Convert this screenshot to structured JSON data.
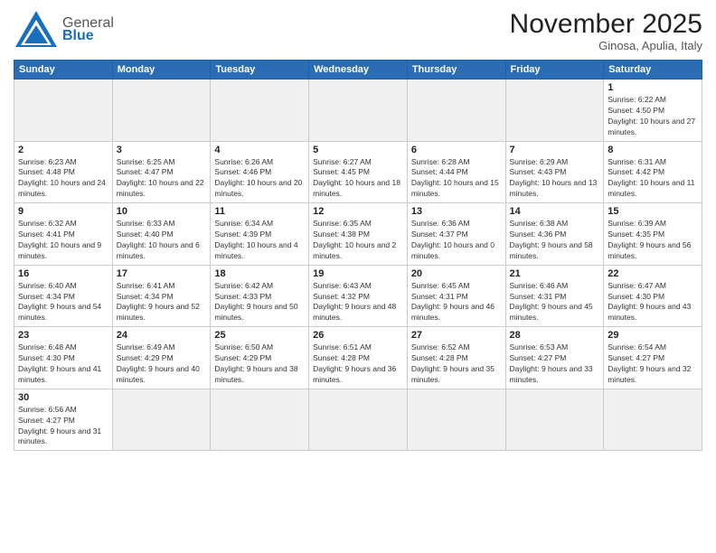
{
  "header": {
    "logo_general": "General",
    "logo_blue": "Blue",
    "month_title": "November 2025",
    "subtitle": "Ginosa, Apulia, Italy"
  },
  "weekdays": [
    "Sunday",
    "Monday",
    "Tuesday",
    "Wednesday",
    "Thursday",
    "Friday",
    "Saturday"
  ],
  "weeks": [
    [
      {
        "day": "",
        "empty": true
      },
      {
        "day": "",
        "empty": true
      },
      {
        "day": "",
        "empty": true
      },
      {
        "day": "",
        "empty": true
      },
      {
        "day": "",
        "empty": true
      },
      {
        "day": "",
        "empty": true
      },
      {
        "day": "1",
        "sunrise": "6:22 AM",
        "sunset": "4:50 PM",
        "daylight": "10 hours and 27 minutes."
      }
    ],
    [
      {
        "day": "2",
        "sunrise": "6:23 AM",
        "sunset": "4:48 PM",
        "daylight": "10 hours and 24 minutes."
      },
      {
        "day": "3",
        "sunrise": "6:25 AM",
        "sunset": "4:47 PM",
        "daylight": "10 hours and 22 minutes."
      },
      {
        "day": "4",
        "sunrise": "6:26 AM",
        "sunset": "4:46 PM",
        "daylight": "10 hours and 20 minutes."
      },
      {
        "day": "5",
        "sunrise": "6:27 AM",
        "sunset": "4:45 PM",
        "daylight": "10 hours and 18 minutes."
      },
      {
        "day": "6",
        "sunrise": "6:28 AM",
        "sunset": "4:44 PM",
        "daylight": "10 hours and 15 minutes."
      },
      {
        "day": "7",
        "sunrise": "6:29 AM",
        "sunset": "4:43 PM",
        "daylight": "10 hours and 13 minutes."
      },
      {
        "day": "8",
        "sunrise": "6:31 AM",
        "sunset": "4:42 PM",
        "daylight": "10 hours and 11 minutes."
      }
    ],
    [
      {
        "day": "9",
        "sunrise": "6:32 AM",
        "sunset": "4:41 PM",
        "daylight": "10 hours and 9 minutes."
      },
      {
        "day": "10",
        "sunrise": "6:33 AM",
        "sunset": "4:40 PM",
        "daylight": "10 hours and 6 minutes."
      },
      {
        "day": "11",
        "sunrise": "6:34 AM",
        "sunset": "4:39 PM",
        "daylight": "10 hours and 4 minutes."
      },
      {
        "day": "12",
        "sunrise": "6:35 AM",
        "sunset": "4:38 PM",
        "daylight": "10 hours and 2 minutes."
      },
      {
        "day": "13",
        "sunrise": "6:36 AM",
        "sunset": "4:37 PM",
        "daylight": "10 hours and 0 minutes."
      },
      {
        "day": "14",
        "sunrise": "6:38 AM",
        "sunset": "4:36 PM",
        "daylight": "9 hours and 58 minutes."
      },
      {
        "day": "15",
        "sunrise": "6:39 AM",
        "sunset": "4:35 PM",
        "daylight": "9 hours and 56 minutes."
      }
    ],
    [
      {
        "day": "16",
        "sunrise": "6:40 AM",
        "sunset": "4:34 PM",
        "daylight": "9 hours and 54 minutes."
      },
      {
        "day": "17",
        "sunrise": "6:41 AM",
        "sunset": "4:34 PM",
        "daylight": "9 hours and 52 minutes."
      },
      {
        "day": "18",
        "sunrise": "6:42 AM",
        "sunset": "4:33 PM",
        "daylight": "9 hours and 50 minutes."
      },
      {
        "day": "19",
        "sunrise": "6:43 AM",
        "sunset": "4:32 PM",
        "daylight": "9 hours and 48 minutes."
      },
      {
        "day": "20",
        "sunrise": "6:45 AM",
        "sunset": "4:31 PM",
        "daylight": "9 hours and 46 minutes."
      },
      {
        "day": "21",
        "sunrise": "6:46 AM",
        "sunset": "4:31 PM",
        "daylight": "9 hours and 45 minutes."
      },
      {
        "day": "22",
        "sunrise": "6:47 AM",
        "sunset": "4:30 PM",
        "daylight": "9 hours and 43 minutes."
      }
    ],
    [
      {
        "day": "23",
        "sunrise": "6:48 AM",
        "sunset": "4:30 PM",
        "daylight": "9 hours and 41 minutes."
      },
      {
        "day": "24",
        "sunrise": "6:49 AM",
        "sunset": "4:29 PM",
        "daylight": "9 hours and 40 minutes."
      },
      {
        "day": "25",
        "sunrise": "6:50 AM",
        "sunset": "4:29 PM",
        "daylight": "9 hours and 38 minutes."
      },
      {
        "day": "26",
        "sunrise": "6:51 AM",
        "sunset": "4:28 PM",
        "daylight": "9 hours and 36 minutes."
      },
      {
        "day": "27",
        "sunrise": "6:52 AM",
        "sunset": "4:28 PM",
        "daylight": "9 hours and 35 minutes."
      },
      {
        "day": "28",
        "sunrise": "6:53 AM",
        "sunset": "4:27 PM",
        "daylight": "9 hours and 33 minutes."
      },
      {
        "day": "29",
        "sunrise": "6:54 AM",
        "sunset": "4:27 PM",
        "daylight": "9 hours and 32 minutes."
      }
    ],
    [
      {
        "day": "30",
        "sunrise": "6:56 AM",
        "sunset": "4:27 PM",
        "daylight": "9 hours and 31 minutes."
      },
      {
        "day": "",
        "empty": true
      },
      {
        "day": "",
        "empty": true
      },
      {
        "day": "",
        "empty": true
      },
      {
        "day": "",
        "empty": true
      },
      {
        "day": "",
        "empty": true
      },
      {
        "day": "",
        "empty": true
      }
    ]
  ]
}
